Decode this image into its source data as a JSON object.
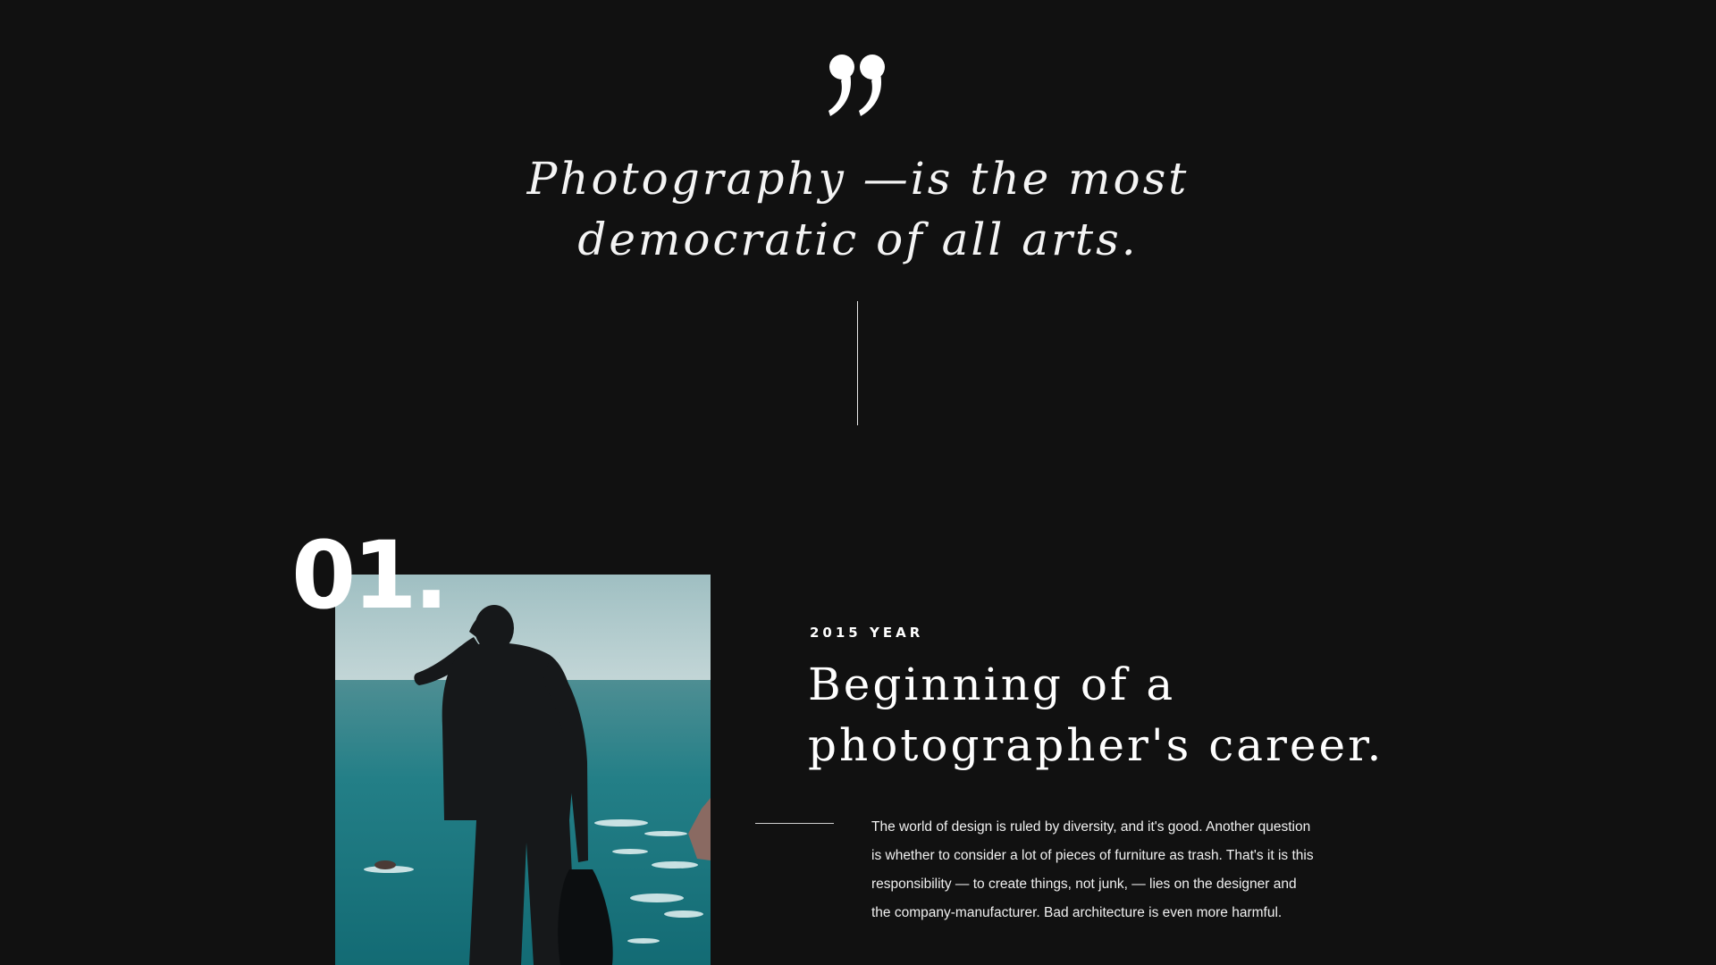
{
  "quote": {
    "mark": "”",
    "line1": "Photography —is the most",
    "line2": "democratic of all arts."
  },
  "milestone": {
    "number": "01.",
    "year": "2015 YEAR",
    "title_line1": "Beginning of a",
    "title_line2": "photographer's career.",
    "body": "The world of design is ruled by diversity, and it's good. Another question is whether to consider a lot of pieces of furniture as trash. That's it is this responsibility — to create things, not junk, — lies on the designer and the company-manufacturer. Bad architecture is even more harmful."
  },
  "colors": {
    "background": "#111111",
    "text": "#ffffff",
    "sea": "#1f7f86",
    "sky": "#a9c6c9"
  }
}
